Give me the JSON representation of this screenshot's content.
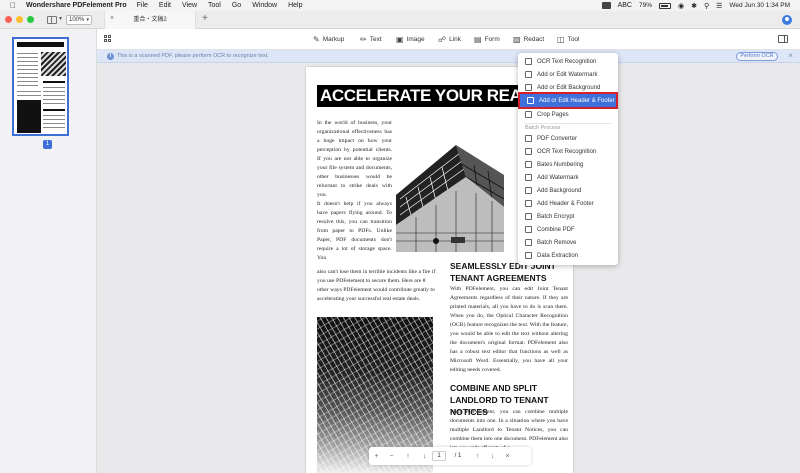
{
  "menubar": {
    "app_name": "Wondershare PDFelement Pro",
    "items": [
      "File",
      "Edit",
      "View",
      "Tool",
      "Go",
      "Window",
      "Help"
    ],
    "battery": "79%",
    "input_source": "ABC",
    "datetime": "Wed Jun 30  1:34 PM"
  },
  "tabbar": {
    "zoom": "100%",
    "tab_title": "重合・文稿2"
  },
  "toolbar": {
    "markup": "Markup",
    "text": "Text",
    "image": "Image",
    "link": "Link",
    "form": "Form",
    "redact": "Redact",
    "tool": "Tool"
  },
  "notice": {
    "text": "This is a scanned PDF, please perform OCR to recognize text.",
    "button": "Perform OCR"
  },
  "thumbnails": {
    "page_number": "1"
  },
  "document": {
    "title": "ACCELERATE YOUR REAL ESTATE",
    "left_column": [
      "In the world of business, your organizational effectiveness has a huge impact on how your perception by potential clients. If you are not able to organize your file system and documents, other businesses would be reluctant to strike deals with you.",
      "It doesn't help if you always have papers flying around. To resolve this, you can transition from paper to PDFs. Unlike Paper, PDF documents don't require a lot of storage space. You"
    ],
    "full_paragraph": "also can't lose them in terrible incidents like a fire if you use PDFelement to secure them. Here are 8 other ways PDFelement would contribute greatly to accelerating your successful real estate deals.",
    "heading_seamless": "SEAMLESSLY EDIT JOINT TENANT AGREEMENTS",
    "para_seamless": "With PDFelement, you can edit Joint Tenant Agreements regardless of their nature. If they are printed materials, all you have to do is scan them. When you do, the Optical Character Recognition (OCR) feature recognizes the text. With the feature, you would be able to edit the text without altering the document's original format. PDFelement also has a robust text editor that functions as well as Microsoft Word. Essentially, you have all your editing needs covered.",
    "heading_combine": "COMBINE AND SPLIT LANDLORD TO TENANT NOTICES",
    "para_combine": "With PDFelement, you can combine multiple documents into one. In a situation where you have multiple Landlord to Tenant Notices, you can combine them into one document. PDFelement also lets you split off parts of a"
  },
  "pagenav": {
    "current": "1",
    "total": "/  1"
  },
  "tool_menu": {
    "items": [
      "OCR Text Recognition",
      "Add or Edit Watermark",
      "Add or Edit Background",
      "Add or Edit Header & Footer",
      "Crop Pages"
    ],
    "batch_label": "Batch Process",
    "batch_items": [
      "PDF Converter",
      "OCR Text Recognition",
      "Bates Numbering",
      "Add Watermark",
      "Add Background",
      "Add Header & Footer",
      "Batch Encrypt",
      "Combine PDF",
      "Batch Remove",
      "Data Extraction"
    ]
  },
  "colors": {
    "accent": "#3f6fd8",
    "highlight_outline": "#d3212c",
    "notice_bg": "#dde6f7"
  }
}
